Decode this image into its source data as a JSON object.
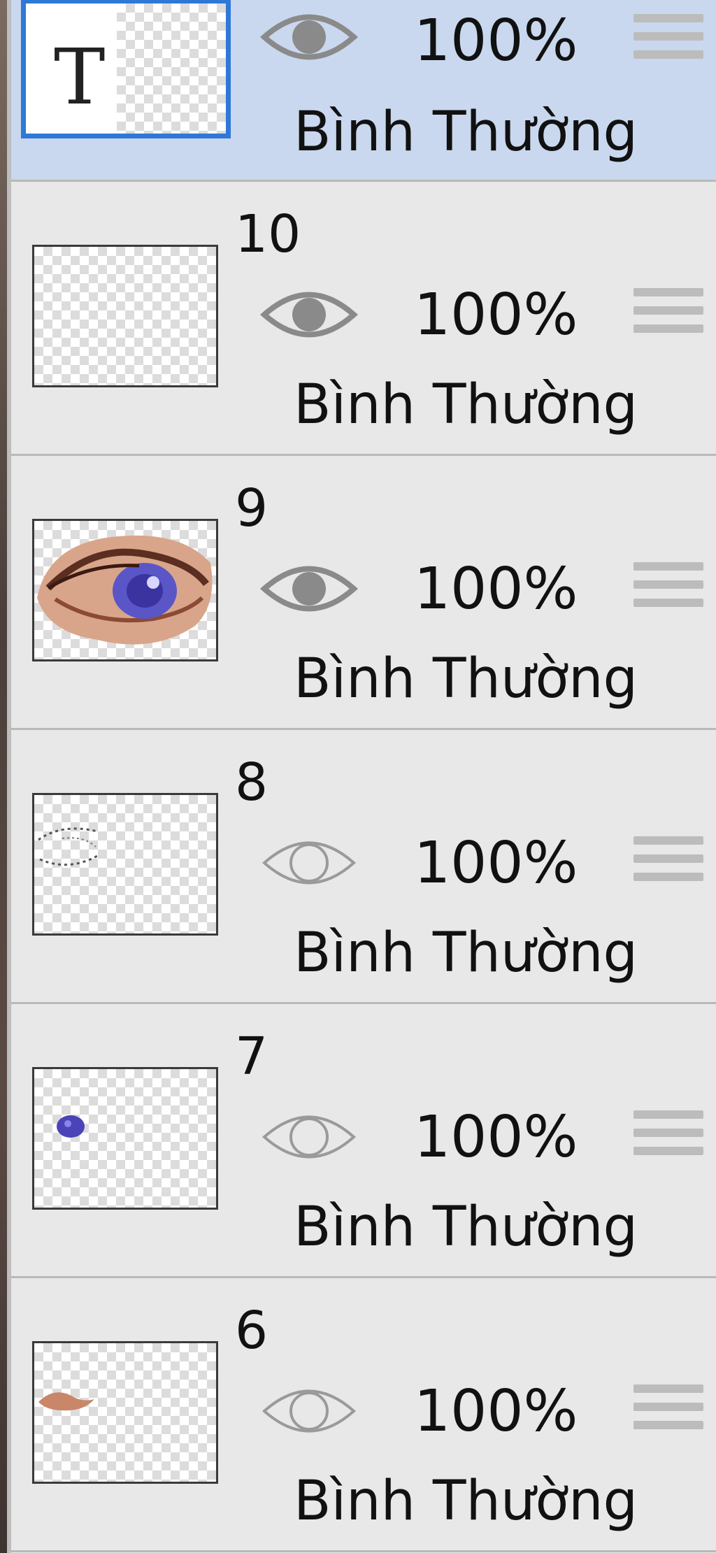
{
  "layers": [
    {
      "name": "",
      "opacity": "100%",
      "blend": "Bình Thường",
      "visible": true,
      "selected": true,
      "thumb": "text-layer",
      "thumb_letter": "T"
    },
    {
      "name": "10",
      "opacity": "100%",
      "blend": "Bình Thường",
      "visible": true,
      "selected": false,
      "thumb": "empty"
    },
    {
      "name": "9",
      "opacity": "100%",
      "blend": "Bình Thường",
      "visible": true,
      "selected": false,
      "thumb": "eye-painting"
    },
    {
      "name": "8",
      "opacity": "100%",
      "blend": "Bình Thường",
      "visible": false,
      "selected": false,
      "thumb": "eye-outline-sketch"
    },
    {
      "name": "7",
      "opacity": "100%",
      "blend": "Bình Thường",
      "visible": false,
      "selected": false,
      "thumb": "purple-iris"
    },
    {
      "name": "6",
      "opacity": "100%",
      "blend": "Bình Thường",
      "visible": false,
      "selected": false,
      "thumb": "skin-stroke"
    }
  ],
  "colors": {
    "selected_background": "#c9d8ee",
    "selected_thumb_border": "#2f78d6",
    "row_background": "#e8e8e8",
    "eye_visible": "#8a8a8a",
    "eye_hidden": "#9a9a9a"
  }
}
